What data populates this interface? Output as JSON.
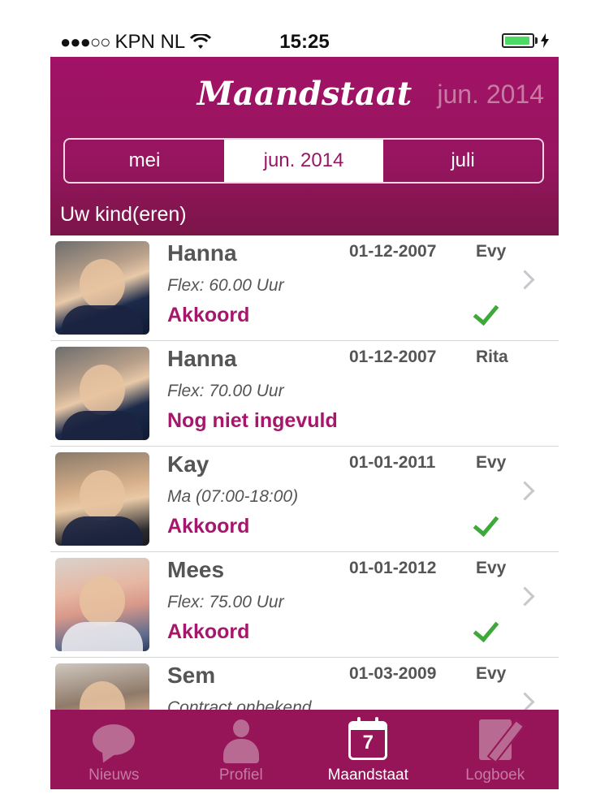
{
  "status_bar": {
    "carrier": "KPN NL",
    "signal": "●●●○○",
    "time": "15:25"
  },
  "header": {
    "title": "Maandstaat",
    "current_month": "jun. 2014"
  },
  "month_selector": [
    {
      "label": "mei"
    },
    {
      "label": "jun. 2014",
      "selected": true
    },
    {
      "label": "juli"
    }
  ],
  "section_title": "Uw kind(eren)",
  "children": [
    {
      "name": "Hanna",
      "date": "01-12-2007",
      "carer": "Evy",
      "contract": "Flex: 60.00 Uur",
      "status": "Akkoord",
      "checked": true,
      "chevron": true
    },
    {
      "name": "Hanna",
      "date": "01-12-2007",
      "carer": "Rita",
      "contract": "Flex: 70.00 Uur",
      "status": "Nog niet ingevuld",
      "checked": false,
      "chevron": false
    },
    {
      "name": "Kay",
      "date": "01-01-2011",
      "carer": "Evy",
      "contract": "Ma (07:00-18:00)",
      "status": "Akkoord",
      "checked": true,
      "chevron": true
    },
    {
      "name": "Mees",
      "date": "01-01-2012",
      "carer": "Evy",
      "contract": "Flex: 75.00 Uur",
      "status": "Akkoord",
      "checked": true,
      "chevron": true
    },
    {
      "name": "Sem",
      "date": "01-03-2009",
      "carer": "Evy",
      "contract": "Contract onbekend",
      "status": "",
      "checked": false,
      "chevron": true
    }
  ],
  "tabs": [
    {
      "label": "Nieuws",
      "icon": "chat-bubble-icon"
    },
    {
      "label": "Profiel",
      "icon": "person-icon"
    },
    {
      "label": "Maandstaat",
      "icon": "calendar-icon",
      "active": true,
      "calendar_day": "7"
    },
    {
      "label": "Logboek",
      "icon": "logbook-pencil-icon"
    }
  ],
  "colors": {
    "brand": "#9b1563",
    "status_text": "#a6176b",
    "check": "#3fa83a",
    "battery": "#4cd964"
  }
}
